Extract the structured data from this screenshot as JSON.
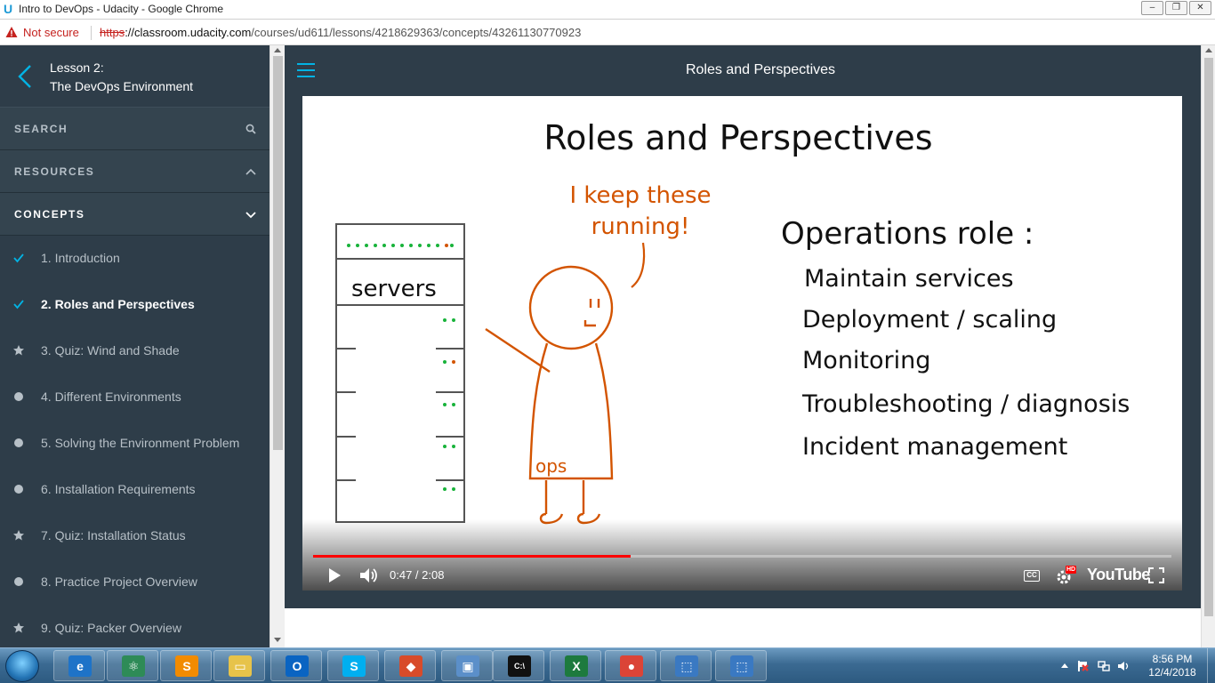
{
  "window": {
    "title": "Intro to DevOps - Udacity - Google Chrome",
    "controls": [
      "–",
      "❐",
      "✕"
    ]
  },
  "addressbar": {
    "security": "Not secure",
    "scheme": "https",
    "host": "://classroom.udacity.com",
    "path": "/courses/ud611/lessons/4218629363/concepts/43261130770923"
  },
  "sidebar": {
    "lesson_number": "Lesson 2:",
    "lesson_name": "The DevOps Environment",
    "sections": [
      {
        "label": "SEARCH",
        "icon": "search-icon"
      },
      {
        "label": "RESOURCES",
        "icon": "chevron-up-icon"
      },
      {
        "label": "CONCEPTS",
        "icon": "chevron-down-icon"
      }
    ],
    "concepts": [
      {
        "label": "1. Introduction",
        "status": "complete"
      },
      {
        "label": "2. Roles and Perspectives",
        "status": "complete",
        "current": true
      },
      {
        "label": "3. Quiz: Wind and Shade",
        "status": "quiz"
      },
      {
        "label": "4. Different Environments",
        "status": "todo"
      },
      {
        "label": "5. Solving the Environment Problem",
        "status": "todo"
      },
      {
        "label": "6. Installation Requirements",
        "status": "todo"
      },
      {
        "label": "7. Quiz: Installation Status",
        "status": "quiz"
      },
      {
        "label": "8. Practice Project Overview",
        "status": "todo"
      },
      {
        "label": "9. Quiz: Packer Overview",
        "status": "quiz"
      }
    ]
  },
  "main": {
    "title": "Roles and Perspectives"
  },
  "video": {
    "slide_title": "Roles and Perspectives",
    "speech": [
      "I keep these",
      "running!"
    ],
    "server_label": "servers",
    "person_label": "ops",
    "role_heading": "Operations role :",
    "role_items": [
      "Maintain services",
      "Deployment / scaling",
      "Monitoring",
      "Troubleshooting / diagnosis",
      "Incident management"
    ],
    "current_time": "0:47",
    "duration": "2:08",
    "progress_fraction": 0.37,
    "cc_label": "CC",
    "hd_badge": "HD",
    "youtube_label": "YouTube"
  },
  "taskbar": {
    "apps": [
      {
        "name": "internet-explorer",
        "glyph": "e",
        "color": "#1e73c8"
      },
      {
        "name": "atom",
        "glyph": "⚛",
        "color": "#2e8b57"
      },
      {
        "name": "sublime-text",
        "glyph": "S",
        "color": "#f28b00"
      },
      {
        "name": "file-explorer",
        "glyph": "▭",
        "color": "#e7c34a"
      },
      {
        "name": "outlook",
        "glyph": "O",
        "color": "#0a64c2"
      },
      {
        "name": "skype",
        "glyph": "S",
        "color": "#00aff0"
      },
      {
        "name": "git",
        "glyph": "◆",
        "color": "#d84b2a"
      },
      {
        "name": "network",
        "glyph": "▣",
        "color": "#5b8fc9"
      },
      {
        "name": "cmd",
        "glyph": "C:\\",
        "color": "#111111"
      },
      {
        "name": "excel",
        "glyph": "X",
        "color": "#1d7a3e"
      },
      {
        "name": "chrome",
        "glyph": "●",
        "color": "#db4437"
      },
      {
        "name": "remote-1",
        "glyph": "⬚",
        "color": "#3a79c2"
      },
      {
        "name": "remote-2",
        "glyph": "⬚",
        "color": "#3a79c2"
      }
    ],
    "time": "8:56 PM",
    "date": "12/4/2018"
  },
  "colors": {
    "sidebar_bg": "#2e3d49",
    "accent": "#02b3e4",
    "marker_red": "#d35400",
    "server_green": "#18b33a",
    "progress_red": "#ff0000"
  }
}
